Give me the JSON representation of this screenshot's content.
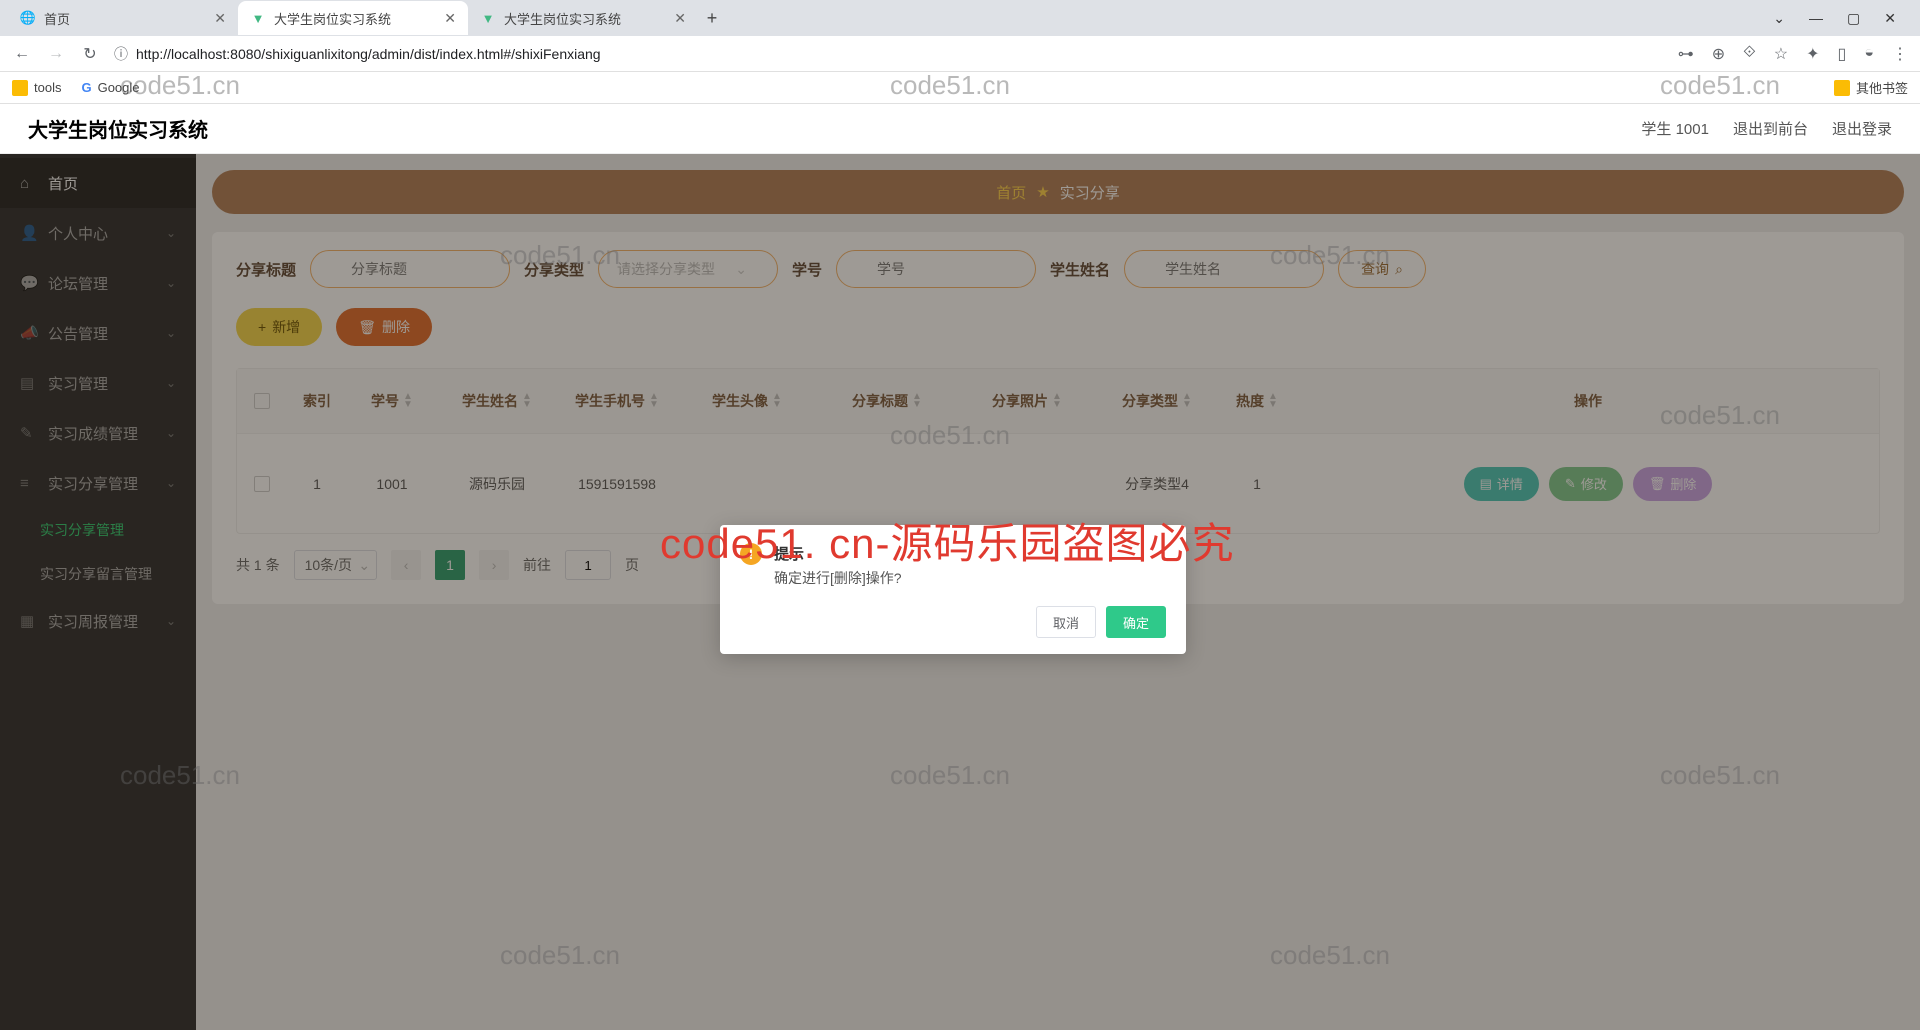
{
  "browser": {
    "tabs": [
      {
        "title": "首页",
        "active": false
      },
      {
        "title": "大学生岗位实习系统",
        "active": true
      },
      {
        "title": "大学生岗位实习系统",
        "active": false
      }
    ],
    "url": "http://localhost:8080/shixiguanlixitong/admin/dist/index.html#/shixiFenxiang",
    "bookmarks": {
      "tools": "tools",
      "google": "Google",
      "other": "其他书签"
    }
  },
  "app": {
    "title": "大学生岗位实习系统",
    "user": "学生 1001",
    "link_front": "退出到前台",
    "link_logout": "退出登录"
  },
  "sidebar": {
    "items": [
      {
        "label": "首页",
        "icon": "home"
      },
      {
        "label": "个人中心",
        "icon": "user",
        "expand": true
      },
      {
        "label": "论坛管理",
        "icon": "forum",
        "expand": true
      },
      {
        "label": "公告管理",
        "icon": "bullhorn",
        "expand": true
      },
      {
        "label": "实习管理",
        "icon": "list",
        "expand": true
      },
      {
        "label": "实习成绩管理",
        "icon": "grade",
        "expand": true
      },
      {
        "label": "实习分享管理",
        "icon": "share",
        "expand": true,
        "open": true
      },
      {
        "label": "实习周报管理",
        "icon": "report",
        "expand": true
      }
    ],
    "subs": [
      {
        "label": "实习分享管理",
        "current": true
      },
      {
        "label": "实习分享留言管理",
        "current": false
      }
    ]
  },
  "crumb": {
    "home": "首页",
    "sep_icon": "star",
    "page": "实习分享"
  },
  "search": {
    "f1_label": "分享标题",
    "f1_ph": "分享标题",
    "f2_label": "分享类型",
    "f2_ph": "请选择分享类型",
    "f3_label": "学号",
    "f3_ph": "学号",
    "f4_label": "学生姓名",
    "f4_ph": "学生姓名",
    "query": "查询"
  },
  "actions": {
    "add": "新增",
    "del": "删除"
  },
  "table": {
    "headers": {
      "idx": "索引",
      "sno": "学号",
      "name": "学生姓名",
      "phone": "学生手机号",
      "avatar": "学生头像",
      "title": "分享标题",
      "photo": "分享照片",
      "type": "分享类型",
      "hot": "热度",
      "op": "操作"
    },
    "rows": [
      {
        "idx": "1",
        "sno": "1001",
        "name": "源码乐园",
        "phone": "1591591598",
        "title": "",
        "type": "分享类型4",
        "hot": "1"
      }
    ],
    "ops": {
      "detail": "详情",
      "edit": "修改",
      "del": "删除"
    }
  },
  "pager": {
    "total": "共 1 条",
    "size": "10条/页",
    "cur": "1",
    "goto": "前往",
    "page_suffix": "页",
    "goto_val": "1"
  },
  "dialog": {
    "title": "提示",
    "msg": "确定进行[删除]操作?",
    "cancel": "取消",
    "ok": "确定"
  },
  "watermark": {
    "small": "code51.cn",
    "big": "code51. cn-源码乐园盗图必究"
  }
}
